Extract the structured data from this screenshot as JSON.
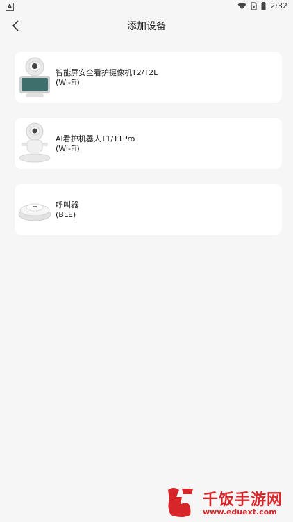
{
  "status_bar": {
    "left_icon_letter": "A",
    "time": "2:32"
  },
  "header": {
    "title": "添加设备"
  },
  "devices": [
    {
      "name": "智能屏安全看护摄像机T2/T2L",
      "connection": "(Wi-Fi)",
      "image_icon": "camera-robot-with-screen-icon"
    },
    {
      "name": "AI看护机器人T1/T1Pro",
      "connection": "(Wi-Fi)",
      "image_icon": "camera-robot-icon"
    },
    {
      "name": "呼叫器",
      "connection": "(BLE)",
      "image_icon": "round-caller-button-icon"
    }
  ],
  "watermark": {
    "logo_text": "千饭手游网",
    "url": "www.eduext.com"
  },
  "colors": {
    "background": "#f6f6f6",
    "card": "#ffffff",
    "watermark_red": "#d6262a"
  }
}
